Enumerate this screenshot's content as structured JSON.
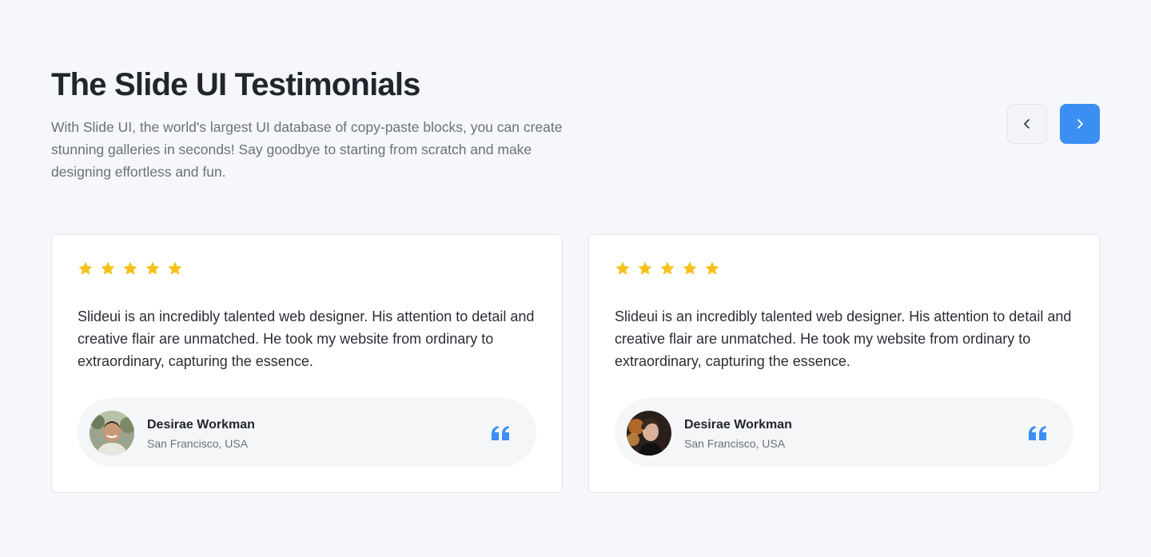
{
  "header": {
    "title": "The Slide UI Testimonials",
    "description": "With Slide UI, the world's largest UI database of copy-paste blocks, you can create stunning galleries in seconds! Say goodbye to starting from scratch and make designing effortless and fun."
  },
  "navigation": {
    "prev_icon": "chevron-left-icon",
    "next_icon": "chevron-right-icon",
    "accent_color": "#3b8ff3"
  },
  "testimonials": [
    {
      "rating": 5,
      "text": "Slideui is an incredibly talented web designer. His attention to detail and creative flair are unmatched. He took my website from ordinary to extraordinary, capturing the essence.",
      "name": "Desirae Workman",
      "location": "San Francisco, USA",
      "avatar": "avatar-man-photo"
    },
    {
      "rating": 5,
      "text": "Slideui is an incredibly talented web designer. His attention to detail and creative flair are unmatched. He took my website from ordinary to extraordinary, capturing the essence.",
      "name": "Desirae Workman",
      "location": "San Francisco, USA",
      "avatar": "avatar-woman-photo"
    }
  ],
  "colors": {
    "star": "#f5c11b",
    "quote_icon": "#3b8ff3",
    "background": "#f6f7fa"
  }
}
